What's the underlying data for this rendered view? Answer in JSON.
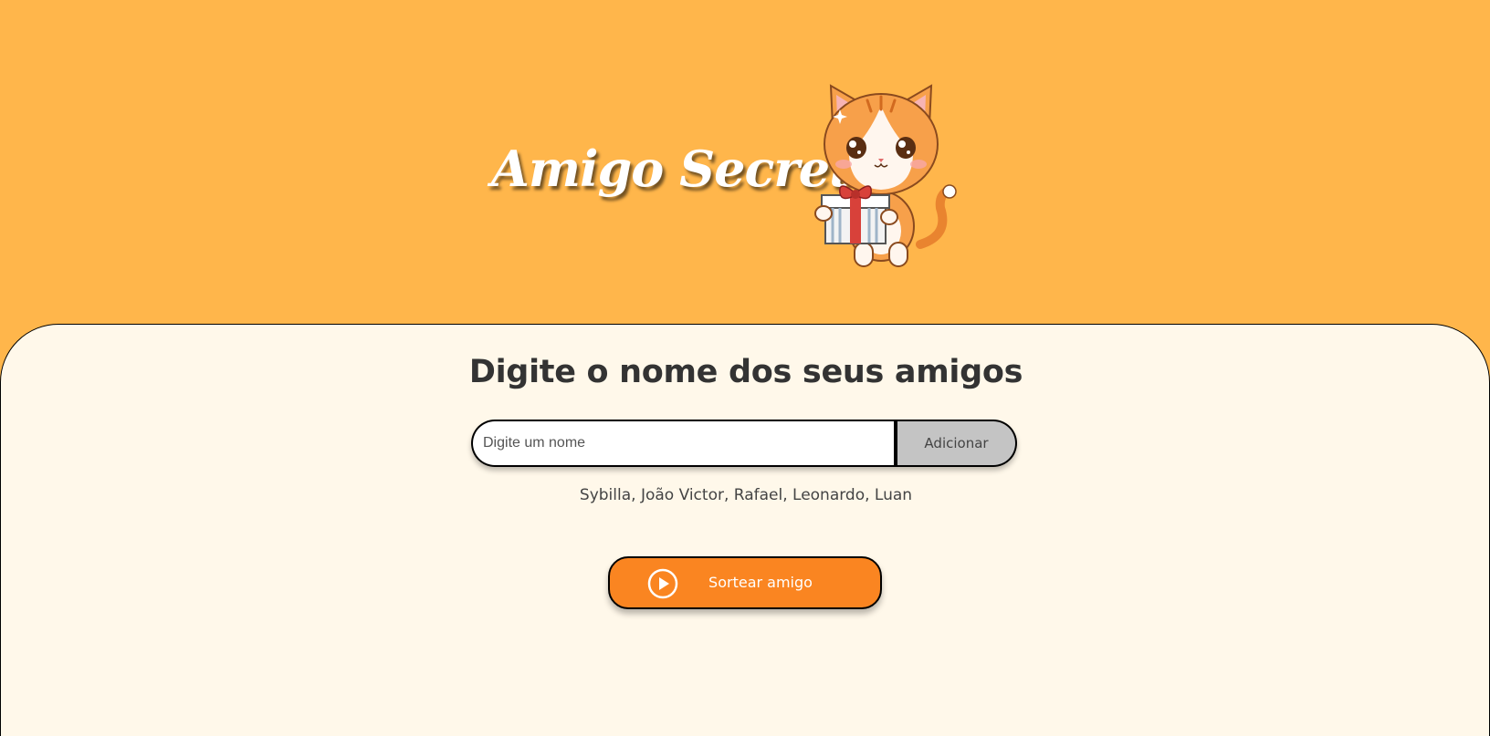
{
  "header": {
    "title": "Amigo Secreto",
    "mascot_icon": "cat-with-gift-icon"
  },
  "main": {
    "heading": "Digite o nome dos seus amigos",
    "name_input": {
      "placeholder": "Digite um nome",
      "value": ""
    },
    "add_button_label": "Adicionar",
    "friends_list": "Sybilla, João Victor, Rafael, Leonardo, Luan",
    "draw_button": {
      "label": "Sortear amigo",
      "icon": "play-circle-icon"
    }
  },
  "colors": {
    "header_background": "#FFB64B",
    "main_background": "#FFF8EA",
    "accent": "#FA8521",
    "add_button": "#C4C4C4",
    "heading_text": "#333333"
  }
}
